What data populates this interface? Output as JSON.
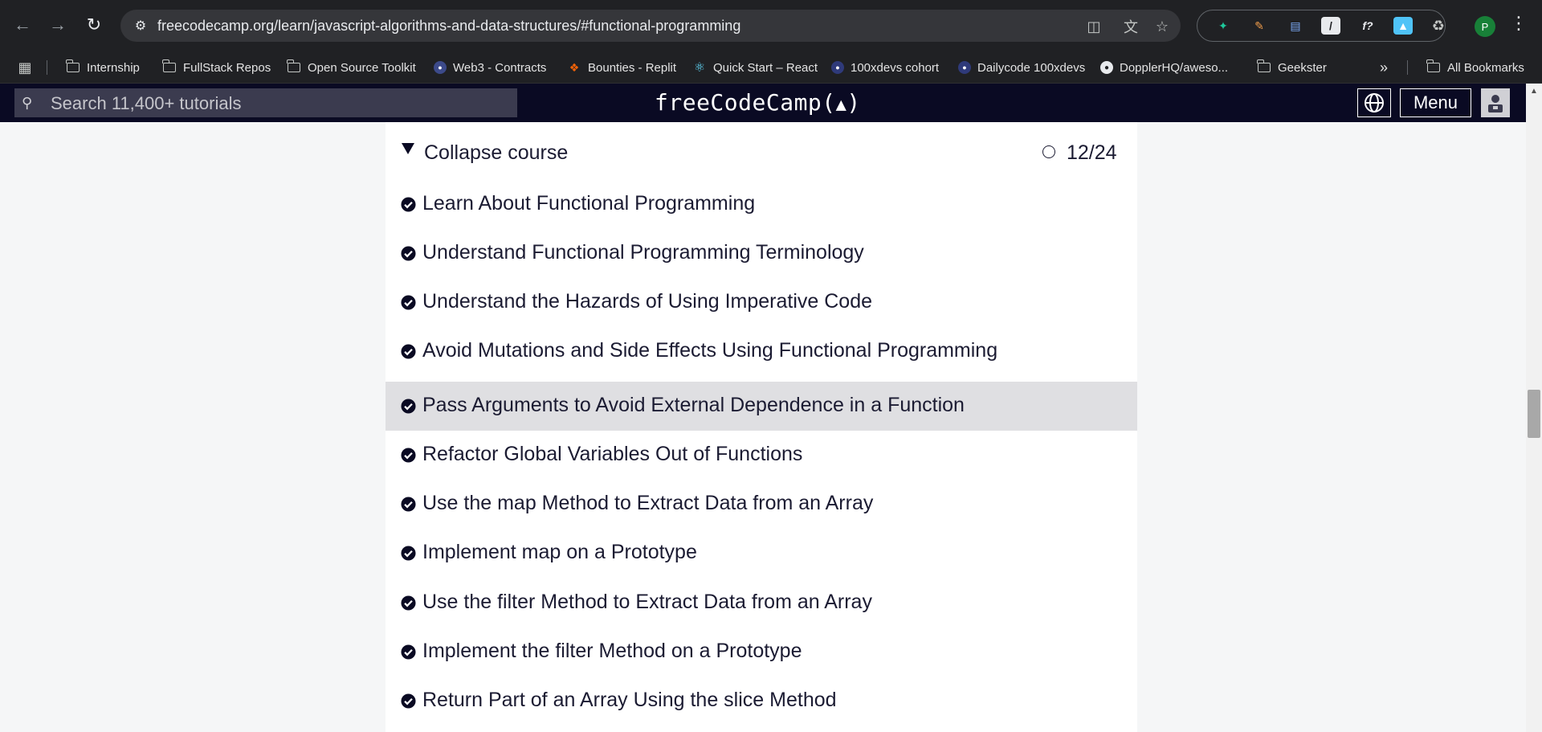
{
  "browser": {
    "url": "freecodecamp.org/learn/javascript-algorithms-and-data-structures/#functional-programming",
    "profile_initial": "P"
  },
  "bookmarks": [
    {
      "label": "Internship",
      "icon": "folder-icon"
    },
    {
      "label": "FullStack Repos",
      "icon": "folder-icon"
    },
    {
      "label": "Open Source Toolkit",
      "icon": "folder-icon"
    },
    {
      "label": "Web3 - Contracts",
      "icon": "site-favicon"
    },
    {
      "label": "Bounties - Replit",
      "icon": "replit-icon"
    },
    {
      "label": "Quick Start – React",
      "icon": "react-icon"
    },
    {
      "label": "100xdevs cohort",
      "icon": "site-favicon"
    },
    {
      "label": "Dailycode 100xdevs",
      "icon": "site-favicon"
    },
    {
      "label": "DopplerHQ/aweso...",
      "icon": "github-icon"
    },
    {
      "label": "Geekster",
      "icon": "folder-icon"
    },
    {
      "label": "All Bookmarks",
      "icon": "folder-icon"
    }
  ],
  "fcc": {
    "search_placeholder": "Search 11,400+ tutorials",
    "logo_text": "freeCodeCamp(",
    "logo_close": ")",
    "menu_label": "Menu"
  },
  "course": {
    "collapse_label": "Collapse course",
    "progress": "12/24",
    "lessons": [
      {
        "label": "Learn About Functional Programming",
        "completed": true
      },
      {
        "label": "Understand Functional Programming Terminology",
        "completed": true
      },
      {
        "label": "Understand the Hazards of Using Imperative Code",
        "completed": true
      },
      {
        "label": "Avoid Mutations and Side Effects Using Functional Programming",
        "completed": true
      },
      {
        "label": "Pass Arguments to Avoid External Dependence in a Function",
        "completed": true
      },
      {
        "label": "Refactor Global Variables Out of Functions",
        "completed": true
      },
      {
        "label": "Use the map Method to Extract Data from an Array",
        "completed": true
      },
      {
        "label": "Implement map on a Prototype",
        "completed": true
      },
      {
        "label": "Use the filter Method to Extract Data from an Array",
        "completed": true
      },
      {
        "label": "Implement the filter Method on a Prototype",
        "completed": true
      },
      {
        "label": "Return Part of an Array Using the slice Method",
        "completed": true
      }
    ]
  },
  "colors": {
    "nav_bg": "#0a0a23",
    "active_row": "#dfdfe2",
    "text": "#1b1b32"
  }
}
